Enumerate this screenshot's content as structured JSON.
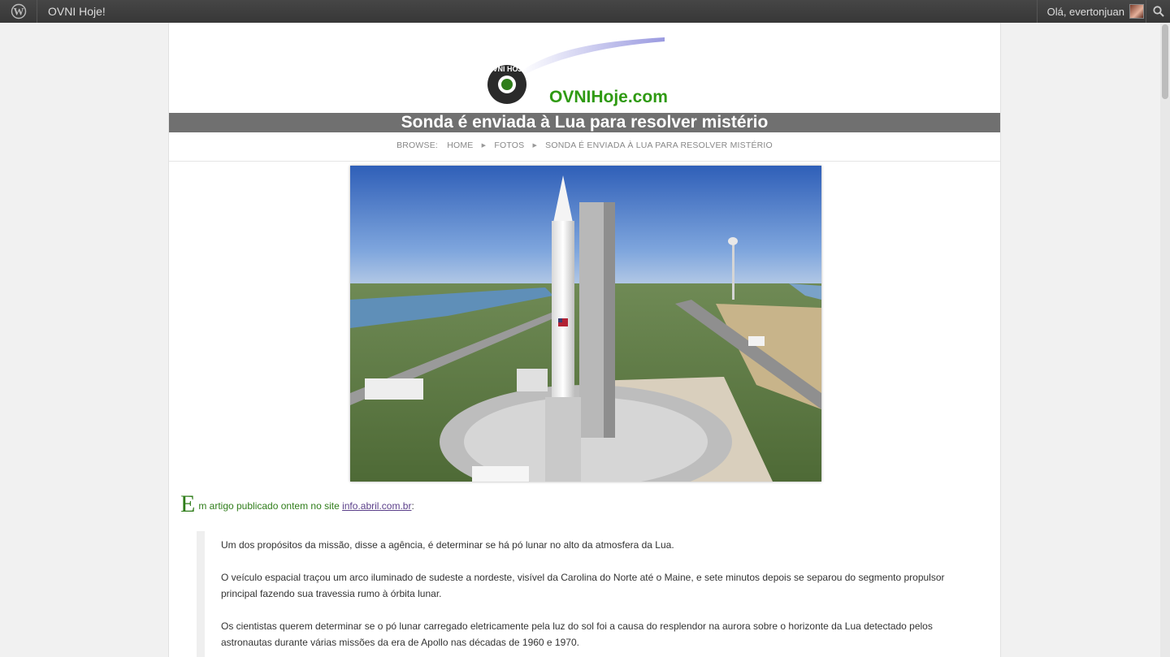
{
  "adminbar": {
    "site_name": "OVNI Hoje!",
    "greeting": "Olá, evertonjuan"
  },
  "header": {
    "logo_text": "OVNIHoje.com",
    "logo_ring_text": "OVNI HOJE"
  },
  "post": {
    "title": "Sonda é enviada à Lua para resolver mistério",
    "breadcrumb": {
      "label": "BROWSE:",
      "items": [
        "HOME",
        "FOTOS",
        "SONDA É ENVIADA À LUA PARA RESOLVER MISTÉRIO"
      ]
    },
    "intro": {
      "dropcap": "E",
      "text": "m artigo publicado ontem no site ",
      "link": "info.abril.com.br",
      "after": ":"
    },
    "quote": [
      "Um dos propósitos da missão, disse a agência, é determinar se há pó lunar no alto da atmosfera da Lua.",
      "O veículo espacial traçou um arco iluminado de sudeste a nordeste, visível da Carolina do Norte até o Maine, e sete minutos depois se separou do segmento propulsor principal fazendo sua travessia rumo à órbita lunar.",
      "Os cientistas querem determinar se o pó lunar carregado eletricamente pela luz do sol foi a causa do resplendor na aurora sobre o horizonte da Lua detectado pelos astronautas durante várias missões da era de Apollo nas décadas de 1960 e 1970."
    ]
  },
  "colors": {
    "adminbar": "#3b3b3b",
    "title_bar": "#707070",
    "accent_green": "#2f7d1a",
    "link": "#5b3f8a"
  }
}
